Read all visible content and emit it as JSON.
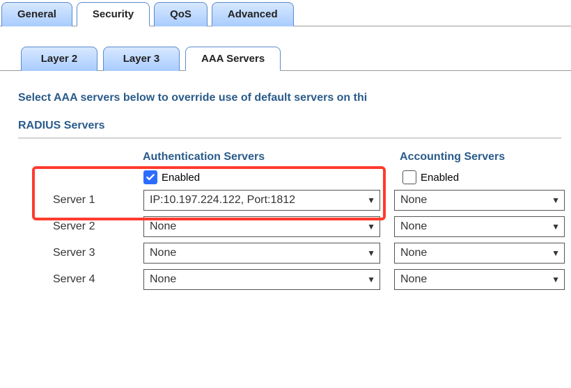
{
  "tabs_top": {
    "general": "General",
    "security": "Security",
    "qos": "QoS",
    "advanced": "Advanced"
  },
  "tabs_sub": {
    "layer2": "Layer 2",
    "layer3": "Layer 3",
    "aaa": "AAA Servers"
  },
  "instruction": "Select AAA servers below to override use of default servers on thi",
  "section_heading": "RADIUS Servers",
  "columns": {
    "auth": "Authentication Servers",
    "acct": "Accounting Servers"
  },
  "enabled_label": "Enabled",
  "auth_enabled": true,
  "acct_enabled": false,
  "servers": [
    {
      "label": "Server 1",
      "auth": "IP:10.197.224.122, Port:1812",
      "acct": "None"
    },
    {
      "label": "Server 2",
      "auth": "None",
      "acct": "None"
    },
    {
      "label": "Server 3",
      "auth": "None",
      "acct": "None"
    },
    {
      "label": "Server 4",
      "auth": "None",
      "acct": "None"
    }
  ]
}
